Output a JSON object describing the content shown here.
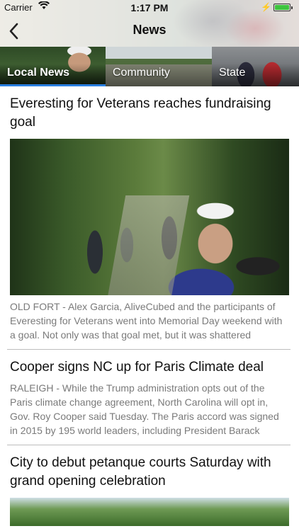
{
  "status_bar": {
    "carrier": "Carrier",
    "time": "1:17 PM",
    "battery_level": 1.0
  },
  "nav": {
    "title": "News",
    "back_icon": "chevron-left-icon"
  },
  "tabs": [
    {
      "label": "Local News",
      "active": true
    },
    {
      "label": "Community",
      "active": false
    },
    {
      "label": "State",
      "active": false
    }
  ],
  "colors": {
    "accent": "#2a7fe0",
    "summary_text": "#7a7a7a",
    "divider": "#bdbdbd"
  },
  "articles": [
    {
      "headline": "Everesting for Veterans reaches fundraising goal",
      "summary": "OLD FORT - Alex Garcia, AliveCubed and the participants of Everesting for Veterans went into Memorial Day weekend with a goal. Not only was that goal met, but it was shattered"
    },
    {
      "headline": "Cooper signs NC up for Paris Climate deal",
      "summary": "RALEIGH - While the Trump administration opts out of the Paris climate change agreement, North Carolina will opt in, Gov. Roy Cooper said Tuesday. The Paris accord was signed in 2015 by 195 world leaders, including President Barack Obama, who promised to reduce greenhouse emissions and"
    },
    {
      "headline": "City to debut petanque courts Saturday with grand opening celebration"
    }
  ]
}
